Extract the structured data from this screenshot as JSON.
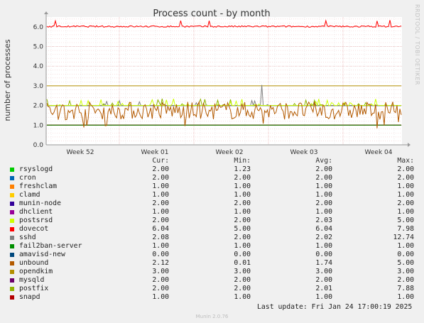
{
  "chart_data": {
    "type": "line",
    "title": "Process count - by month",
    "ylabel": "number of processes",
    "ylim": [
      0,
      6.5
    ],
    "yticks": [
      "0.0",
      "1.0",
      "2.0",
      "3.0",
      "4.0",
      "5.0",
      "6.0"
    ],
    "xticks": [
      "Week 52",
      "Week 01",
      "Week 02",
      "Week 03",
      "Week 04"
    ],
    "side_label": "RRDTOOL / TOBI OETIKER",
    "grid": true,
    "series": [
      {
        "name": "rsyslogd",
        "color": "#00cc00",
        "cur": "2.00",
        "min": "1.23",
        "avg": "2.00",
        "max": "2.00"
      },
      {
        "name": "cron",
        "color": "#0066b3",
        "cur": "2.00",
        "min": "2.00",
        "avg": "2.00",
        "max": "2.00"
      },
      {
        "name": "freshclam",
        "color": "#ff8000",
        "cur": "1.00",
        "min": "1.00",
        "avg": "1.00",
        "max": "1.00"
      },
      {
        "name": "clamd",
        "color": "#ffcc00",
        "cur": "1.00",
        "min": "1.00",
        "avg": "1.00",
        "max": "1.00"
      },
      {
        "name": "munin-node",
        "color": "#330099",
        "cur": "2.00",
        "min": "2.00",
        "avg": "2.00",
        "max": "2.00"
      },
      {
        "name": "dhclient",
        "color": "#990099",
        "cur": "1.00",
        "min": "1.00",
        "avg": "1.00",
        "max": "1.00"
      },
      {
        "name": "postsrsd",
        "color": "#ccff00",
        "cur": "2.00",
        "min": "2.00",
        "avg": "2.03",
        "max": "5.00"
      },
      {
        "name": "dovecot",
        "color": "#ff0000",
        "cur": "6.04",
        "min": "5.00",
        "avg": "6.04",
        "max": "7.98"
      },
      {
        "name": "sshd",
        "color": "#808080",
        "cur": "2.08",
        "min": "2.00",
        "avg": "2.02",
        "max": "12.74"
      },
      {
        "name": "fail2ban-server",
        "color": "#008f00",
        "cur": "1.00",
        "min": "1.00",
        "avg": "1.00",
        "max": "1.00"
      },
      {
        "name": "amavisd-new",
        "color": "#00487d",
        "cur": "0.00",
        "min": "0.00",
        "avg": "0.00",
        "max": "0.00"
      },
      {
        "name": "unbound",
        "color": "#b35a00",
        "cur": "2.12",
        "min": "0.01",
        "avg": "1.74",
        "max": "5.00"
      },
      {
        "name": "opendkim",
        "color": "#b38f00",
        "cur": "3.00",
        "min": "3.00",
        "avg": "3.00",
        "max": "3.00"
      },
      {
        "name": "mysqld",
        "color": "#6b006b",
        "cur": "2.00",
        "min": "2.00",
        "avg": "2.00",
        "max": "2.00"
      },
      {
        "name": "postfix",
        "color": "#8fb300",
        "cur": "2.00",
        "min": "2.00",
        "avg": "2.01",
        "max": "7.88"
      },
      {
        "name": "snapd",
        "color": "#b30000",
        "cur": "1.00",
        "min": "1.00",
        "avg": "1.00",
        "max": "1.00"
      }
    ]
  },
  "legend_headers": {
    "cur": "Cur:",
    "min": "Min:",
    "avg": "Avg:",
    "max": "Max:"
  },
  "last_update": "Last update: Fri Jan 24 17:00:19 2025",
  "footer": "Munin 2.0.76"
}
